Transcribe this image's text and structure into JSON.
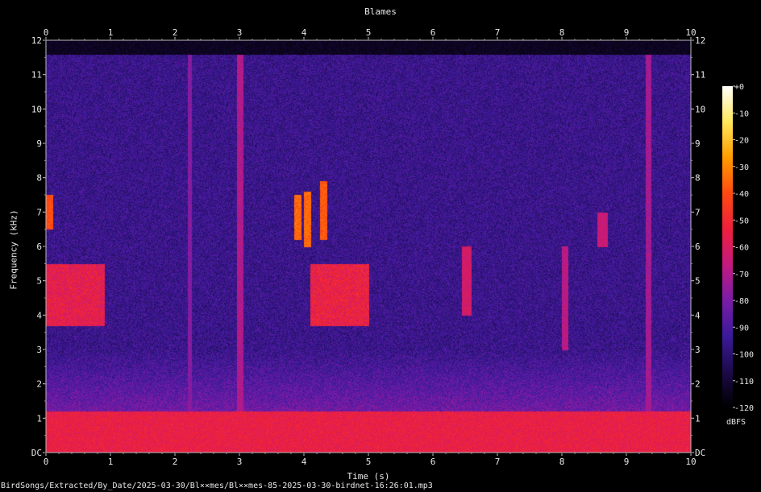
{
  "chart_data": {
    "type": "heatmap",
    "title": "Blames",
    "xlabel": "Time (s)",
    "ylabel": "Frequency (kHz)",
    "xlim": [
      0,
      10
    ],
    "ylim": [
      0,
      12
    ],
    "x_ticks": [
      "0",
      "1",
      "2",
      "3",
      "4",
      "5",
      "6",
      "7",
      "8",
      "9",
      "10"
    ],
    "y_ticks": [
      "DC",
      "1",
      "2",
      "3",
      "4",
      "5",
      "6",
      "7",
      "8",
      "9",
      "10",
      "11",
      "12"
    ],
    "colorbar": {
      "label": "dBFS",
      "range": [
        -120,
        0
      ],
      "ticks": [
        "+0",
        "-10",
        "-20",
        "-30",
        "-40",
        "-50",
        "-60",
        "-70",
        "-80",
        "-90",
        "-100",
        "-110",
        "-120"
      ],
      "colormap": [
        "#000000",
        "#1c0a4a",
        "#3b1a9b",
        "#7a1ca8",
        "#c31a80",
        "#ef1f3c",
        "#ff4a10",
        "#ff9c00",
        "#ffe85a",
        "#ffffff"
      ]
    },
    "approximate_energy_cutoff_khz": 11.6,
    "background_level_dbfs": -95,
    "low_band": {
      "freq_khz": [
        0,
        1.2
      ],
      "level_dbfs": -55
    },
    "events": [
      {
        "label": "call",
        "time_s": [
          0.0,
          0.1
        ],
        "freq_khz": [
          6.5,
          7.5
        ],
        "level_dbfs": -40
      },
      {
        "label": "call",
        "time_s": [
          3.85,
          3.95
        ],
        "freq_khz": [
          6.2,
          7.5
        ],
        "level_dbfs": -35
      },
      {
        "label": "call",
        "time_s": [
          4.0,
          4.1
        ],
        "freq_khz": [
          6.0,
          7.6
        ],
        "level_dbfs": -35
      },
      {
        "label": "call",
        "time_s": [
          4.25,
          4.35
        ],
        "freq_khz": [
          6.2,
          7.9
        ],
        "level_dbfs": -38
      },
      {
        "label": "band",
        "time_s": [
          0.0,
          0.9
        ],
        "freq_khz": [
          3.7,
          5.5
        ],
        "level_dbfs": -60
      },
      {
        "label": "band",
        "time_s": [
          4.1,
          5.0
        ],
        "freq_khz": [
          3.7,
          5.5
        ],
        "level_dbfs": -58
      },
      {
        "label": "transient",
        "time_s": [
          2.95,
          3.05
        ],
        "freq_khz": [
          0,
          11.6
        ],
        "level_dbfs": -70
      },
      {
        "label": "transient",
        "time_s": [
          2.2,
          2.25
        ],
        "freq_khz": [
          0,
          11.6
        ],
        "level_dbfs": -78
      },
      {
        "label": "transient",
        "time_s": [
          9.3,
          9.38
        ],
        "freq_khz": [
          0,
          11.6
        ],
        "level_dbfs": -72
      },
      {
        "label": "sweep",
        "time_s": [
          6.45,
          6.6
        ],
        "freq_khz": [
          4.0,
          6.0
        ],
        "level_dbfs": -62
      },
      {
        "label": "sweep",
        "time_s": [
          8.0,
          8.1
        ],
        "freq_khz": [
          3.0,
          6.0
        ],
        "level_dbfs": -68
      },
      {
        "label": "sweep",
        "time_s": [
          8.55,
          8.7
        ],
        "freq_khz": [
          6.0,
          7.0
        ],
        "level_dbfs": -65
      }
    ]
  },
  "footer": "BirdSongs/Extracted/By_Date/2025-03-30/Bl××mes/Bl××mes-85-2025-03-30-birdnet-16:26:01.mp3"
}
